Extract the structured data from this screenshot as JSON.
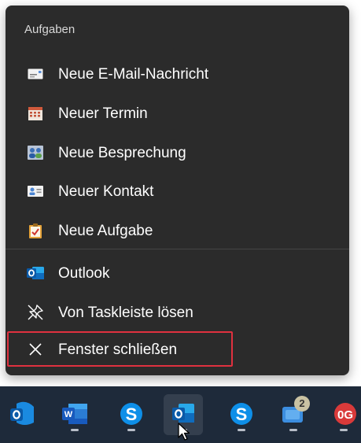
{
  "jumplist": {
    "section_title": "Aufgaben",
    "tasks": [
      {
        "label": "Neue E-Mail-Nachricht",
        "icon": "envelope-icon"
      },
      {
        "label": "Neuer Termin",
        "icon": "calendar-icon"
      },
      {
        "label": "Neue Besprechung",
        "icon": "people-icon"
      },
      {
        "label": "Neuer Kontakt",
        "icon": "contact-card-icon"
      },
      {
        "label": "Neue Aufgabe",
        "icon": "clipboard-task-icon"
      }
    ],
    "app_items": [
      {
        "label": "Outlook",
        "icon": "outlook-icon"
      },
      {
        "label": "Von Taskleiste lösen",
        "icon": "unpin-icon"
      },
      {
        "label": "Fenster schließen",
        "icon": "close-icon"
      }
    ]
  },
  "taskbar": {
    "apps": [
      {
        "name": "outlook-new",
        "icon": "outlook-icon",
        "letter": "O"
      },
      {
        "name": "word",
        "icon": "word-icon",
        "letter": "W"
      },
      {
        "name": "skype",
        "icon": "skype-icon",
        "letter": "S"
      },
      {
        "name": "outlook-classic",
        "icon": "outlook-icon",
        "letter": "O",
        "active": true
      },
      {
        "name": "skype-2",
        "icon": "skype-icon",
        "letter": "S"
      },
      {
        "name": "chat",
        "icon": "chat-icon",
        "badge": "2"
      },
      {
        "name": "app-og",
        "icon": "og-icon",
        "letter": "0G"
      }
    ]
  },
  "colors": {
    "menu_bg": "#2b2b2b",
    "highlight_border": "#e0313f",
    "taskbar_bg": "#1e2a3a",
    "outlook_blue": "#0f6cbd"
  }
}
